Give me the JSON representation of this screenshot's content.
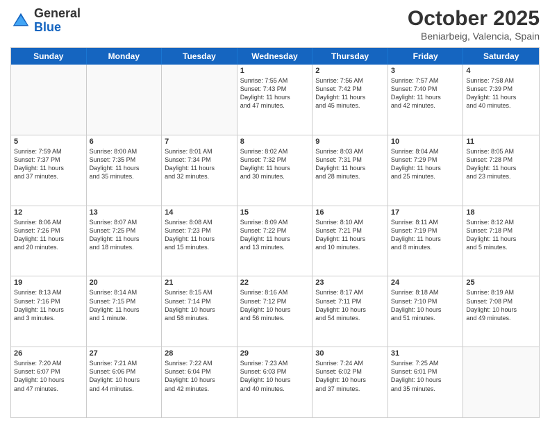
{
  "logo": {
    "general": "General",
    "blue": "Blue"
  },
  "header": {
    "month": "October 2025",
    "location": "Beniarbeig, Valencia, Spain"
  },
  "days": [
    "Sunday",
    "Monday",
    "Tuesday",
    "Wednesday",
    "Thursday",
    "Friday",
    "Saturday"
  ],
  "weeks": [
    [
      {
        "day": "",
        "info": ""
      },
      {
        "day": "",
        "info": ""
      },
      {
        "day": "",
        "info": ""
      },
      {
        "day": "1",
        "info": "Sunrise: 7:55 AM\nSunset: 7:43 PM\nDaylight: 11 hours\nand 47 minutes."
      },
      {
        "day": "2",
        "info": "Sunrise: 7:56 AM\nSunset: 7:42 PM\nDaylight: 11 hours\nand 45 minutes."
      },
      {
        "day": "3",
        "info": "Sunrise: 7:57 AM\nSunset: 7:40 PM\nDaylight: 11 hours\nand 42 minutes."
      },
      {
        "day": "4",
        "info": "Sunrise: 7:58 AM\nSunset: 7:39 PM\nDaylight: 11 hours\nand 40 minutes."
      }
    ],
    [
      {
        "day": "5",
        "info": "Sunrise: 7:59 AM\nSunset: 7:37 PM\nDaylight: 11 hours\nand 37 minutes."
      },
      {
        "day": "6",
        "info": "Sunrise: 8:00 AM\nSunset: 7:35 PM\nDaylight: 11 hours\nand 35 minutes."
      },
      {
        "day": "7",
        "info": "Sunrise: 8:01 AM\nSunset: 7:34 PM\nDaylight: 11 hours\nand 32 minutes."
      },
      {
        "day": "8",
        "info": "Sunrise: 8:02 AM\nSunset: 7:32 PM\nDaylight: 11 hours\nand 30 minutes."
      },
      {
        "day": "9",
        "info": "Sunrise: 8:03 AM\nSunset: 7:31 PM\nDaylight: 11 hours\nand 28 minutes."
      },
      {
        "day": "10",
        "info": "Sunrise: 8:04 AM\nSunset: 7:29 PM\nDaylight: 11 hours\nand 25 minutes."
      },
      {
        "day": "11",
        "info": "Sunrise: 8:05 AM\nSunset: 7:28 PM\nDaylight: 11 hours\nand 23 minutes."
      }
    ],
    [
      {
        "day": "12",
        "info": "Sunrise: 8:06 AM\nSunset: 7:26 PM\nDaylight: 11 hours\nand 20 minutes."
      },
      {
        "day": "13",
        "info": "Sunrise: 8:07 AM\nSunset: 7:25 PM\nDaylight: 11 hours\nand 18 minutes."
      },
      {
        "day": "14",
        "info": "Sunrise: 8:08 AM\nSunset: 7:23 PM\nDaylight: 11 hours\nand 15 minutes."
      },
      {
        "day": "15",
        "info": "Sunrise: 8:09 AM\nSunset: 7:22 PM\nDaylight: 11 hours\nand 13 minutes."
      },
      {
        "day": "16",
        "info": "Sunrise: 8:10 AM\nSunset: 7:21 PM\nDaylight: 11 hours\nand 10 minutes."
      },
      {
        "day": "17",
        "info": "Sunrise: 8:11 AM\nSunset: 7:19 PM\nDaylight: 11 hours\nand 8 minutes."
      },
      {
        "day": "18",
        "info": "Sunrise: 8:12 AM\nSunset: 7:18 PM\nDaylight: 11 hours\nand 5 minutes."
      }
    ],
    [
      {
        "day": "19",
        "info": "Sunrise: 8:13 AM\nSunset: 7:16 PM\nDaylight: 11 hours\nand 3 minutes."
      },
      {
        "day": "20",
        "info": "Sunrise: 8:14 AM\nSunset: 7:15 PM\nDaylight: 11 hours\nand 1 minute."
      },
      {
        "day": "21",
        "info": "Sunrise: 8:15 AM\nSunset: 7:14 PM\nDaylight: 10 hours\nand 58 minutes."
      },
      {
        "day": "22",
        "info": "Sunrise: 8:16 AM\nSunset: 7:12 PM\nDaylight: 10 hours\nand 56 minutes."
      },
      {
        "day": "23",
        "info": "Sunrise: 8:17 AM\nSunset: 7:11 PM\nDaylight: 10 hours\nand 54 minutes."
      },
      {
        "day": "24",
        "info": "Sunrise: 8:18 AM\nSunset: 7:10 PM\nDaylight: 10 hours\nand 51 minutes."
      },
      {
        "day": "25",
        "info": "Sunrise: 8:19 AM\nSunset: 7:08 PM\nDaylight: 10 hours\nand 49 minutes."
      }
    ],
    [
      {
        "day": "26",
        "info": "Sunrise: 7:20 AM\nSunset: 6:07 PM\nDaylight: 10 hours\nand 47 minutes."
      },
      {
        "day": "27",
        "info": "Sunrise: 7:21 AM\nSunset: 6:06 PM\nDaylight: 10 hours\nand 44 minutes."
      },
      {
        "day": "28",
        "info": "Sunrise: 7:22 AM\nSunset: 6:04 PM\nDaylight: 10 hours\nand 42 minutes."
      },
      {
        "day": "29",
        "info": "Sunrise: 7:23 AM\nSunset: 6:03 PM\nDaylight: 10 hours\nand 40 minutes."
      },
      {
        "day": "30",
        "info": "Sunrise: 7:24 AM\nSunset: 6:02 PM\nDaylight: 10 hours\nand 37 minutes."
      },
      {
        "day": "31",
        "info": "Sunrise: 7:25 AM\nSunset: 6:01 PM\nDaylight: 10 hours\nand 35 minutes."
      },
      {
        "day": "",
        "info": ""
      }
    ]
  ]
}
